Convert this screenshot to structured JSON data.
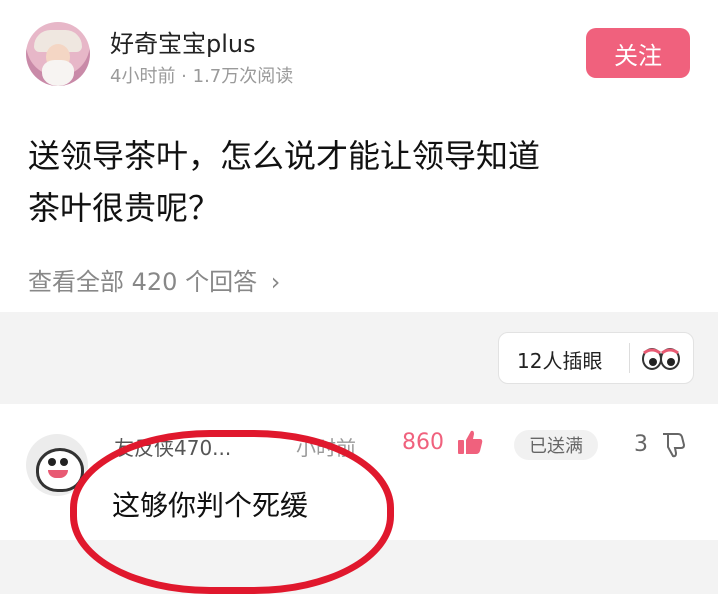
{
  "post": {
    "username": "好奇宝宝plus",
    "meta": "4小时前 · 1.7万次阅读",
    "follow_label": "关注",
    "title_line1": "送领导茶叶，怎么说才能让领导知道",
    "title_line2": "茶叶很贵呢？",
    "view_all": "查看全部 420 个回答",
    "view_all_chevron": "›"
  },
  "poke": {
    "label": "12人插眼",
    "icon": "eyes-icon"
  },
  "comment": {
    "username": "友反侠470...",
    "time": "小时前",
    "likes": "860",
    "sent_badge": "已送满",
    "dislike_count": "3",
    "text": "这够你判个死缓"
  },
  "colors": {
    "accent": "#f0617d",
    "annotation": "#e0182d"
  }
}
